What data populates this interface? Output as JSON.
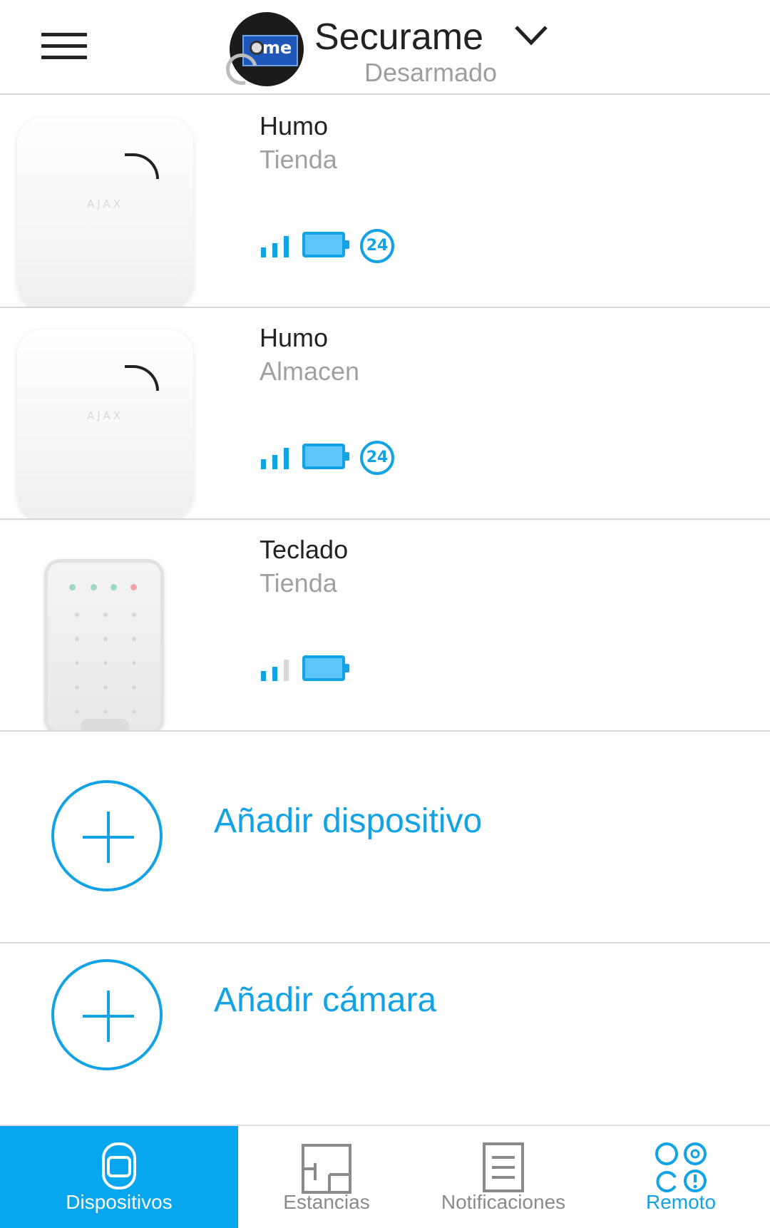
{
  "header": {
    "hub_name": "Securame",
    "hub_state": "Desarmado",
    "avatar_text": "me"
  },
  "devices": [
    {
      "name": "Humo",
      "room": "Tienda",
      "icon": "smoke-detector",
      "signal_bars": 3,
      "battery_level": 1.0,
      "badge": "24"
    },
    {
      "name": "Humo",
      "room": "Almacen",
      "icon": "smoke-detector",
      "signal_bars": 3,
      "battery_level": 1.0,
      "badge": "24"
    },
    {
      "name": "Teclado",
      "room": "Tienda",
      "icon": "keypad",
      "signal_bars": 2,
      "battery_level": 1.0,
      "badge": ""
    }
  ],
  "device_brand": "AJAX",
  "actions": {
    "add_device": "Añadir dispositivo",
    "add_camera": "Añadir cámara"
  },
  "bottom_nav": [
    {
      "label": "Dispositivos",
      "icon": "devices-icon",
      "active": true
    },
    {
      "label": "Estancias",
      "icon": "rooms-icon",
      "active": false
    },
    {
      "label": "Notificaciones",
      "icon": "notifications-icon",
      "active": false
    },
    {
      "label": "Remoto",
      "icon": "remote-icon",
      "active": false
    }
  ],
  "colors": {
    "accent": "#12a2e6",
    "active_tab_bg": "#07a6ee",
    "muted_text": "#9e9e9e"
  }
}
